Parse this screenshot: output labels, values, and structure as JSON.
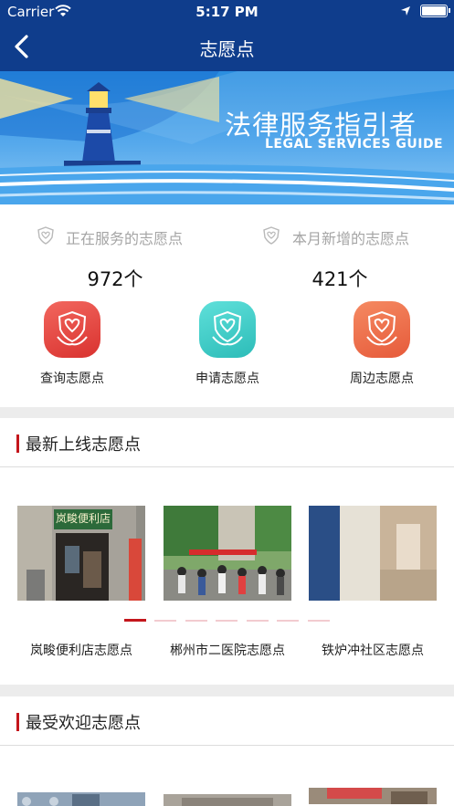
{
  "status_bar": {
    "carrier": "Carrier",
    "time": "5:17 PM"
  },
  "nav": {
    "title": "志愿点"
  },
  "banner": {
    "title_cn": "法律服务指引者",
    "title_en": "LEGAL SERVICES GUIDE"
  },
  "stats": {
    "serving": {
      "label": "正在服务的志愿点",
      "value": "972个"
    },
    "new_this_month": {
      "label": "本月新增的志愿点",
      "value": "421个"
    }
  },
  "actions": [
    {
      "label": "查询志愿点",
      "color": "#e8463e"
    },
    {
      "label": "申请志愿点",
      "color": "#3fcdc8"
    },
    {
      "label": "周边志愿点",
      "color": "#f0704a"
    }
  ],
  "latest": {
    "title": "最新上线志愿点",
    "items": [
      {
        "caption": "岚畯便利店志愿点",
        "sign_text": "岚畯便利店"
      },
      {
        "caption": "郴州市二医院志愿点"
      },
      {
        "caption": "铁炉冲社区志愿点"
      }
    ],
    "carousel": {
      "pages": 7,
      "active": 0
    }
  },
  "popular": {
    "title": "最受欢迎志愿点"
  },
  "colors": {
    "nav_bg": "#0f3d8c",
    "accent_red": "#c4161c"
  }
}
